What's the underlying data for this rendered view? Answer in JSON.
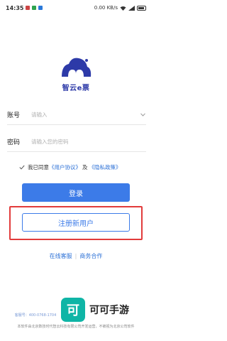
{
  "status": {
    "time": "14:35",
    "net_speed": "0.00 KB/s",
    "battery_icon": "battery-icon"
  },
  "logo": {
    "app_name": "智云e票"
  },
  "form": {
    "account_label": "账号",
    "account_placeholder": "请输入",
    "password_label": "密码",
    "password_placeholder": "请输入您的密码"
  },
  "agreement": {
    "prefix": "我已同意",
    "user_agreement": "《用户协议》",
    "and": "及",
    "privacy_policy": "《隐私政策》"
  },
  "buttons": {
    "login": "登录",
    "register": "注册新用户"
  },
  "links": {
    "online_support": "在线客服",
    "business": "商务合作"
  },
  "footer": {
    "line1": "客服号：400-0768-1704",
    "line2": "本软件由北京数技时代智云科技有限公司开发运营，不被视为北京公司软件"
  },
  "watermark": {
    "logo_glyph": "可",
    "text": "可可手游"
  },
  "colors": {
    "primary": "#3c7be8",
    "highlight": "#e23b3b",
    "brand": "#2d3aa8"
  }
}
